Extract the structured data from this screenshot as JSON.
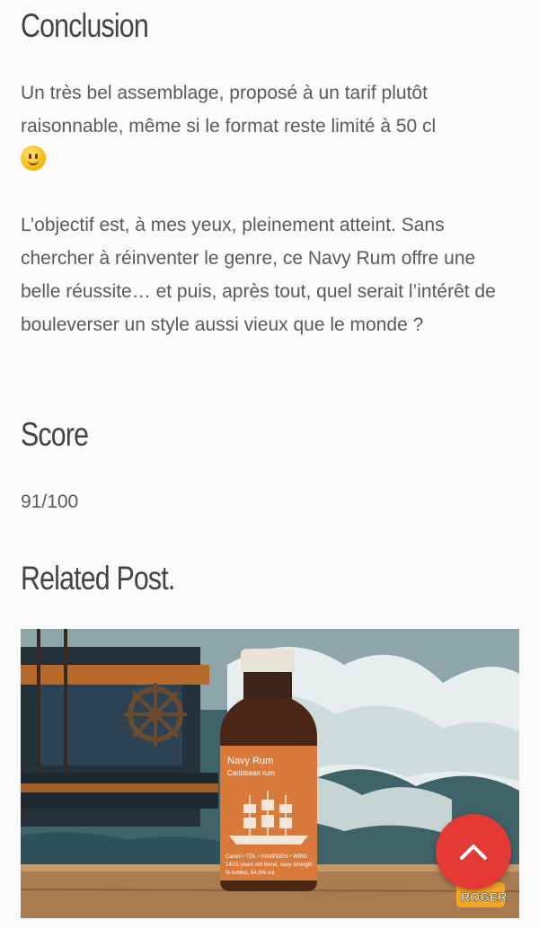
{
  "conclusion": {
    "heading": "Conclusion",
    "paragraph1": "Un très bel assemblage, proposé à un tarif plutôt raisonnable, même si le format reste limité à 50 cl",
    "paragraph2": "L’objectif est, à mes yeux, pleinement atteint. Sans chercher à réinventer le genre, ce Navy Rum offre une belle réussite… et puis, après tout, quel serait l’intérêt de bouleverser un style aussi vieux que le monde ?"
  },
  "score": {
    "heading": "Score",
    "value": "91/100"
  },
  "related": {
    "heading": "Related Post.",
    "bottle_label_title": "Navy Rum",
    "bottle_label_subtitle": "Caribbean rum",
    "bottle_label_line1": "Caroni • TDL • HAMPDEN • WIRD",
    "bottle_label_line2": "14/15 years old blend, navy strength",
    "bottle_label_line3": "% bottles, 54,5% vol.",
    "watermark": "ROGER"
  },
  "icons": {
    "smiley": "slightly-smiling-face-icon",
    "scroll_top": "chevron-up-icon"
  },
  "colors": {
    "accent": "#e53935",
    "label": "#d97a3a"
  }
}
